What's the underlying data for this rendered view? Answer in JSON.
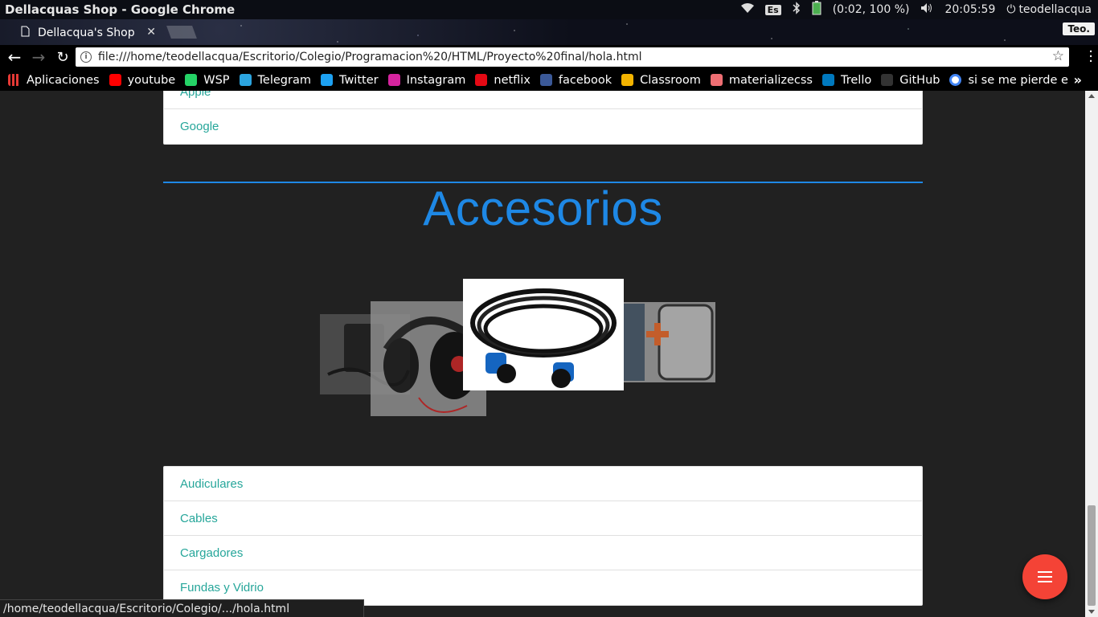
{
  "os": {
    "window_title": "Dellacquas Shop - Google Chrome",
    "keyboard_layout": "Es",
    "battery": "(0:02, 100 %)",
    "clock": "20:05:59",
    "user": "teodellacqua"
  },
  "browser": {
    "tab_title": "Dellacqua's Shop",
    "profile": "Teo.",
    "url": "file:///home/teodellacqua/Escritorio/Colegio/Programacion%20/HTML/Proyecto%20final/hola.html",
    "bookmarks": [
      {
        "label": "Aplicaciones",
        "icon": "apps-grid-icon",
        "color": "#e53935"
      },
      {
        "label": "youtube",
        "icon": "youtube-icon",
        "color": "#ff0000"
      },
      {
        "label": "WSP",
        "icon": "whatsapp-icon",
        "color": "#25d366"
      },
      {
        "label": "Telegram",
        "icon": "telegram-icon",
        "color": "#2ca5e0"
      },
      {
        "label": "Twitter",
        "icon": "twitter-icon",
        "color": "#1da1f2"
      },
      {
        "label": "Instagram",
        "icon": "instagram-icon",
        "color": "#d6249f"
      },
      {
        "label": "netflix",
        "icon": "netflix-icon",
        "color": "#e50914"
      },
      {
        "label": "facebook",
        "icon": "facebook-icon",
        "color": "#3b5998"
      },
      {
        "label": "Classroom",
        "icon": "classroom-icon",
        "color": "#f4b400"
      },
      {
        "label": "materializecss",
        "icon": "materialize-icon",
        "color": "#ee6e73"
      },
      {
        "label": "Trello",
        "icon": "trello-icon",
        "color": "#0079bf"
      },
      {
        "label": "GitHub",
        "icon": "github-icon",
        "color": "#333333"
      },
      {
        "label": "si se me pierde e",
        "icon": "google-icon",
        "color": "#ffffff"
      }
    ],
    "status_url": "/home/teodellacqua/Escritorio/Colegio/.../hola.html"
  },
  "page": {
    "top_collection": [
      "Apple",
      "Google"
    ],
    "section_title": "Accesorios",
    "carousel": [
      "charger-image",
      "headphones-image",
      "cable-image",
      "phone-case-image"
    ],
    "accessories": [
      "Audiculares",
      "Cables",
      "Cargadores",
      "Fundas y Vidrio"
    ],
    "accent": "#1e88e5",
    "link_color": "#26a69a",
    "fab_color": "#f44336"
  }
}
